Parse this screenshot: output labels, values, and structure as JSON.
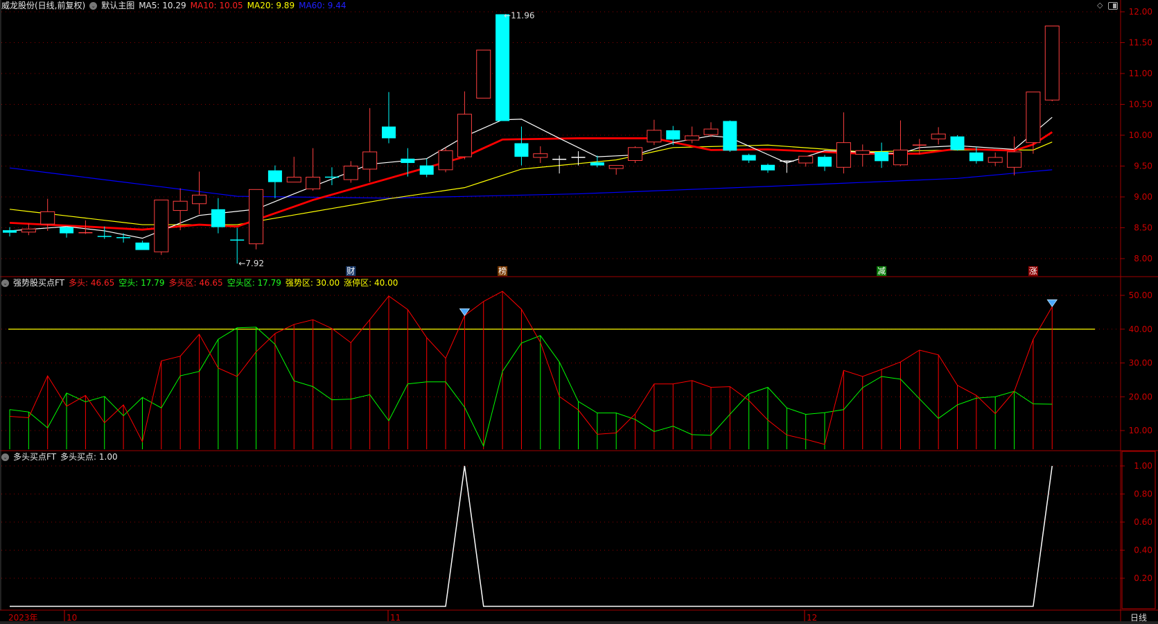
{
  "header": {
    "stock_title": "威龙股份(日线,前复权)",
    "main_chart_label": "默认主图",
    "ma5": "MA5: 10.29",
    "ma10": "MA10: 10.05",
    "ma20": "MA20: 9.89",
    "ma60": "MA60: 9.44"
  },
  "indicator1": {
    "name": "强势股买点FT",
    "bull": "多头: 46.65",
    "bear": "空头: 17.79",
    "bull_zone": "多头区: 46.65",
    "bear_zone": "空头区: 17.79",
    "strong_zone": "强势区: 30.00",
    "limit_zone": "涨停区: 40.00"
  },
  "indicator2": {
    "name": "多头买点FT",
    "buy_point": "多头买点: 1.00"
  },
  "x_axis": {
    "year_label": "2023年",
    "months": [
      {
        "label": "10",
        "index": 3
      },
      {
        "label": "11",
        "index": 20
      },
      {
        "label": "12",
        "index": 42
      }
    ],
    "period_label": "日线"
  },
  "colors": {
    "up": "#ff4040",
    "down": "#00ffff",
    "ma5": "#ffffff",
    "ma10": "#ff0000",
    "ma20": "#ffff00",
    "ma60": "#0000ff",
    "grid": "#8b0000",
    "axis": "#cc0000"
  },
  "chart_data": [
    {
      "type": "candlestick",
      "title": "威龙股份 日线",
      "ylim": [
        7.75,
        12.2
      ],
      "y_ticks": [
        "12.00",
        "11.50",
        "11.00",
        "10.50",
        "10.00",
        "9.50",
        "9.00",
        "8.50",
        "8.00"
      ],
      "ohlc": [
        [
          8.46,
          8.51,
          8.36,
          8.42
        ],
        [
          8.43,
          8.57,
          8.38,
          8.48
        ],
        [
          8.56,
          8.97,
          8.45,
          8.76
        ],
        [
          8.51,
          8.52,
          8.34,
          8.41
        ],
        [
          8.42,
          8.62,
          8.4,
          8.42
        ],
        [
          8.36,
          8.52,
          8.32,
          8.36
        ],
        [
          8.34,
          8.41,
          8.26,
          8.34
        ],
        [
          8.26,
          8.29,
          8.14,
          8.14
        ],
        [
          8.11,
          8.95,
          8.06,
          8.95
        ],
        [
          8.78,
          9.14,
          8.46,
          8.93
        ],
        [
          8.89,
          9.41,
          8.72,
          9.03
        ],
        [
          8.8,
          8.98,
          8.41,
          8.51
        ],
        [
          8.3,
          8.5,
          7.92,
          8.3
        ],
        [
          8.24,
          9.12,
          8.15,
          9.12
        ],
        [
          9.43,
          9.51,
          8.98,
          9.24
        ],
        [
          9.24,
          9.65,
          9.24,
          9.32
        ],
        [
          9.13,
          9.79,
          9.1,
          9.32
        ],
        [
          9.32,
          9.48,
          9.19,
          9.32
        ],
        [
          9.28,
          9.58,
          9.23,
          9.5
        ],
        [
          9.45,
          10.44,
          9.24,
          9.73
        ],
        [
          10.14,
          10.7,
          9.87,
          9.95
        ],
        [
          9.62,
          9.79,
          9.33,
          9.55
        ],
        [
          9.51,
          9.62,
          9.32,
          9.36
        ],
        [
          9.44,
          9.8,
          9.4,
          9.75
        ],
        [
          9.65,
          10.71,
          9.61,
          10.34
        ],
        [
          10.6,
          11.38,
          10.6,
          11.38
        ],
        [
          11.96,
          11.96,
          10.23,
          10.23
        ],
        [
          9.87,
          10.14,
          9.51,
          9.65
        ],
        [
          9.64,
          9.82,
          9.55,
          9.7
        ],
        [
          9.61,
          9.67,
          9.38,
          9.61
        ],
        [
          9.64,
          9.74,
          9.51,
          9.64
        ],
        [
          9.56,
          9.67,
          9.48,
          9.51
        ],
        [
          9.46,
          9.51,
          9.36,
          9.51
        ],
        [
          9.59,
          9.82,
          9.55,
          9.8
        ],
        [
          9.89,
          10.25,
          9.84,
          10.08
        ],
        [
          10.08,
          10.15,
          9.84,
          9.93
        ],
        [
          9.92,
          10.14,
          9.87,
          9.99
        ],
        [
          10.01,
          10.21,
          9.97,
          10.1
        ],
        [
          10.23,
          10.24,
          9.73,
          9.75
        ],
        [
          9.68,
          9.7,
          9.55,
          9.59
        ],
        [
          9.52,
          9.54,
          9.39,
          9.43
        ],
        [
          9.58,
          9.59,
          9.39,
          9.58
        ],
        [
          9.55,
          9.66,
          9.49,
          9.66
        ],
        [
          9.65,
          9.68,
          9.42,
          9.49
        ],
        [
          9.48,
          10.37,
          9.38,
          9.88
        ],
        [
          9.69,
          9.85,
          9.49,
          9.75
        ],
        [
          9.73,
          9.88,
          9.47,
          9.58
        ],
        [
          9.52,
          10.24,
          9.5,
          9.76
        ],
        [
          9.84,
          9.94,
          9.69,
          9.84
        ],
        [
          9.94,
          10.13,
          9.85,
          10.02
        ],
        [
          9.98,
          10.0,
          9.75,
          9.76
        ],
        [
          9.72,
          9.81,
          9.54,
          9.58
        ],
        [
          9.56,
          9.72,
          9.5,
          9.64
        ],
        [
          9.48,
          9.98,
          9.35,
          9.73
        ],
        [
          9.88,
          10.7,
          9.7,
          10.7
        ],
        [
          10.57,
          11.77,
          10.55,
          11.77
        ]
      ],
      "doji_colors": {
        "4": "up",
        "5": "down",
        "6": "down",
        "12": "down",
        "17": "down",
        "29": "white",
        "30": "white",
        "41": "white",
        "48": "up"
      },
      "ma_keypoints": {
        "ma5": [
          [
            0,
            8.45
          ],
          [
            3,
            8.52
          ],
          [
            5,
            8.45
          ],
          [
            7,
            8.33
          ],
          [
            10,
            8.7
          ],
          [
            13,
            8.8
          ],
          [
            15,
            9.05
          ],
          [
            19,
            9.53
          ],
          [
            22,
            9.62
          ],
          [
            24,
            9.98
          ],
          [
            26,
            10.25
          ],
          [
            27,
            10.26
          ],
          [
            29,
            9.95
          ],
          [
            31,
            9.65
          ],
          [
            33,
            9.68
          ],
          [
            35,
            9.88
          ],
          [
            37,
            9.99
          ],
          [
            38,
            9.96
          ],
          [
            41,
            9.55
          ],
          [
            43,
            9.75
          ],
          [
            47,
            9.7
          ],
          [
            48,
            9.8
          ],
          [
            50,
            9.83
          ],
          [
            53,
            9.77
          ],
          [
            55,
            10.29
          ]
        ],
        "ma10": [
          [
            0,
            8.58
          ],
          [
            4,
            8.52
          ],
          [
            7,
            8.47
          ],
          [
            10,
            8.55
          ],
          [
            12,
            8.52
          ],
          [
            16,
            8.95
          ],
          [
            20,
            9.3
          ],
          [
            24,
            9.65
          ],
          [
            26,
            9.93
          ],
          [
            30,
            9.95
          ],
          [
            34,
            9.95
          ],
          [
            37,
            9.76
          ],
          [
            40,
            9.77
          ],
          [
            45,
            9.7
          ],
          [
            48,
            9.7
          ],
          [
            50,
            9.78
          ],
          [
            53,
            9.75
          ],
          [
            54,
            9.85
          ],
          [
            55,
            10.05
          ]
        ],
        "ma20": [
          [
            0,
            8.8
          ],
          [
            7,
            8.55
          ],
          [
            12,
            8.55
          ],
          [
            20,
            8.97
          ],
          [
            24,
            9.15
          ],
          [
            27,
            9.45
          ],
          [
            32,
            9.6
          ],
          [
            35,
            9.8
          ],
          [
            40,
            9.84
          ],
          [
            45,
            9.73
          ],
          [
            50,
            9.76
          ],
          [
            54,
            9.76
          ],
          [
            55,
            9.89
          ]
        ],
        "ma60": [
          [
            0,
            9.47
          ],
          [
            12,
            9.01
          ],
          [
            20,
            8.98
          ],
          [
            30,
            9.05
          ],
          [
            40,
            9.17
          ],
          [
            50,
            9.3
          ],
          [
            55,
            9.44
          ]
        ]
      },
      "annotations": [
        {
          "index": 12,
          "text": "7.92",
          "at": "low"
        },
        {
          "index": 26,
          "text": "11.96",
          "at": "high"
        }
      ],
      "event_markers": [
        {
          "index": 18,
          "text": "财",
          "bg": "#1a3a6a"
        },
        {
          "index": 26,
          "text": "榜",
          "bg": "#7a3a00"
        },
        {
          "index": 46,
          "text": "减",
          "bg": "#0a7a0a"
        },
        {
          "index": 54,
          "text": "涨",
          "bg": "#8b0000"
        }
      ]
    },
    {
      "type": "line",
      "title": "强势股买点FT",
      "ylim": [
        4.4,
        55
      ],
      "y_ticks": [
        "50.00",
        "40.00",
        "30.00",
        "20.00",
        "10.00"
      ],
      "threshold_line": 40,
      "series": [
        {
          "name": "多头",
          "color": "#ff0000",
          "values": [
            14.2,
            13.8,
            26.2,
            17.2,
            20.4,
            12.3,
            17.6,
            6.7,
            30.6,
            32.0,
            38.5,
            28.5,
            26.0,
            33.3,
            38.7,
            41.4,
            42.8,
            40.2,
            36.0,
            42.8,
            49.8,
            45.8,
            37.5,
            31.4,
            44.0,
            48.2,
            51.2,
            45.9,
            36.1,
            20.1,
            16.1,
            8.9,
            9.3,
            14.9,
            23.8,
            23.8,
            24.8,
            22.8,
            23.0,
            18.9,
            13.1,
            8.7,
            7.4,
            5.9,
            27.8,
            26.0,
            28.1,
            30.3,
            33.8,
            32.4,
            23.4,
            20.4,
            15.0,
            21.6,
            37.0,
            46.65
          ]
        },
        {
          "name": "空头",
          "color": "#00ff00",
          "values": [
            16.2,
            15.5,
            10.8,
            21.1,
            18.5,
            20.1,
            14.4,
            19.8,
            16.7,
            26.2,
            27.5,
            37.0,
            40.4,
            40.6,
            35.5,
            24.7,
            23.0,
            19.1,
            19.3,
            20.6,
            12.9,
            23.8,
            24.4,
            24.4,
            16.9,
            5.4,
            27.5,
            35.9,
            38.1,
            30.3,
            18.6,
            15.2,
            15.2,
            13.3,
            9.7,
            11.3,
            8.8,
            8.6,
            14.8,
            20.9,
            22.8,
            16.7,
            14.8,
            15.3,
            16.2,
            22.7,
            26.0,
            25.2,
            19.4,
            13.6,
            17.6,
            19.6,
            20.0,
            21.6,
            17.9,
            17.79
          ]
        }
      ],
      "signal_indices": [
        24,
        55
      ]
    },
    {
      "type": "line",
      "title": "多头买点FT",
      "ylim": [
        0,
        1.02
      ],
      "y_ticks": [
        "1.00",
        "0.80",
        "0.60",
        "0.40",
        "0.20"
      ],
      "series": [
        {
          "name": "多头买点",
          "color": "#ffffff",
          "values": [
            0,
            0,
            0,
            0,
            0,
            0,
            0,
            0,
            0,
            0,
            0,
            0,
            0,
            0,
            0,
            0,
            0,
            0,
            0,
            0,
            0,
            0,
            0,
            0,
            1,
            0,
            0,
            0,
            0,
            0,
            0,
            0,
            0,
            0,
            0,
            0,
            0,
            0,
            0,
            0,
            0,
            0,
            0,
            0,
            0,
            0,
            0,
            0,
            0,
            0,
            0,
            0,
            0,
            0,
            0,
            1
          ]
        }
      ]
    }
  ]
}
